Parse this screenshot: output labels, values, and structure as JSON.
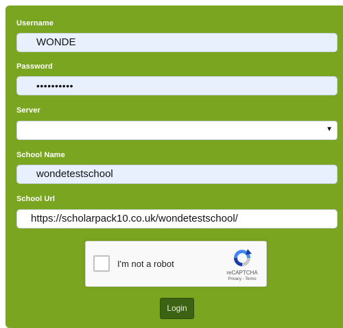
{
  "form": {
    "username": {
      "label": "Username",
      "value": "WONDE"
    },
    "password": {
      "label": "Password",
      "value": "••••••••••"
    },
    "server": {
      "label": "Server",
      "value": ""
    },
    "school_name": {
      "label": "School Name",
      "value": "wondetestschool"
    },
    "school_url": {
      "label": "School Url",
      "value": "https://scholarpack10.co.uk/wondetestschool/"
    }
  },
  "recaptcha": {
    "checkbox_label": "I'm not a robot",
    "brand": "reCAPTCHA",
    "privacy": "Privacy",
    "separator": " - ",
    "terms": "Terms"
  },
  "login_label": "Login",
  "colors": {
    "panel": "#7aa520",
    "input_autofill": "#e8f0fe",
    "login_button": "#3c6314"
  },
  "icons": {
    "select_arrow": "dropdown-arrow-icon",
    "recaptcha": "recaptcha-logo-icon"
  }
}
